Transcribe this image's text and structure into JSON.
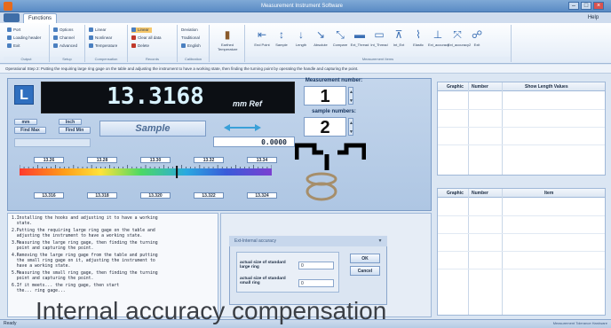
{
  "window": {
    "title": "Measurement Instrument Software"
  },
  "ribbon": {
    "tab": "Functions",
    "help": "Help",
    "groups": [
      {
        "label": "Output",
        "items": [
          "Port",
          "Loading header",
          "Exit"
        ]
      },
      {
        "label": "Setup",
        "items": [
          "Options",
          "Channel",
          "Advanced"
        ]
      },
      {
        "label": "Compensation",
        "items": [
          "Linear",
          "Nonlinear",
          "Temperature"
        ]
      },
      {
        "label": "Records",
        "items": [
          "Clear all data",
          "Delete"
        ]
      },
      {
        "label": "Calibration",
        "items": [
          "Deviation",
          "Traditional",
          "English"
        ]
      }
    ],
    "tools": [
      "Earthed Temperature",
      "End Point",
      "Sample",
      "Length",
      "Absolute",
      "Compare",
      "Ext_Thread",
      "Int_Thread",
      "Int_Ext",
      "Elastic",
      "Ext_accuracy",
      "Ext_accuracy2",
      "Exit"
    ],
    "tools_label": "Measurement Items"
  },
  "instruction": "Operational Step 2: Putting the requiring large ring gage on the table and adjusting the instrument to have a working state, then finding the turning point by operating the handle and capturing the point.",
  "display": {
    "value": "13.3168",
    "unit": "mm  Ref",
    "logo": "L",
    "measurement_number_label": "Measurement number:",
    "measurement_number": "1",
    "sample_number_label": "sample numbers:",
    "sample_number": "2",
    "mm_label": "mm",
    "inch_label": "Inch",
    "find_max": "Find Max",
    "find_min": "Find Min",
    "sample_button": "Sample",
    "zero_value": "0.0000",
    "top_ticks": [
      "13.26",
      "13.28",
      "13.30",
      "13.32",
      "13.34"
    ],
    "bottom_ticks": [
      "13.316",
      "13.318",
      "13.320",
      "13.322",
      "13.324"
    ],
    "level": 0.62
  },
  "steps": [
    "1.Installing the hooks and adjusting it to have a working\n  state.",
    "2.Putting the requiring large ring gage on the table and\n  adjusting the instrument to have a working state.",
    "3.Measuring the large ring gage, then finding the turning\n  point and capturing the point.",
    "4.Removing the large ring gage from the table and putting\n  the small ring gage on it, adjusting the instrument to\n  have a working state.",
    "5.Measuring the small ring gage, then finding the turning\n  point and capturing the point.",
    "6.If it meets... the ring gage, then start\n  the... ring gage..."
  ],
  "dialog": {
    "title": "Ext-Internal accuracy",
    "label_large": "actual size of standard large ring",
    "value_large": "0",
    "label_small": "actual size of standard small ring",
    "value_small": "0",
    "ok": "OK",
    "cancel": "Cancel"
  },
  "table_top": {
    "headers": [
      "Graphic",
      "Number",
      "Show Length Values"
    ]
  },
  "table_bottom": {
    "headers": [
      "Graphic",
      "Number",
      "Item"
    ]
  },
  "status": {
    "ready": "Ready",
    "right": "Measurement Tolerance Hardware"
  },
  "caption": "Internal accuracy compensation",
  "colors": {
    "accent": "#2f6fbf",
    "readout_bg": "#0c0f14",
    "readout_text": "#d8f2ff"
  }
}
